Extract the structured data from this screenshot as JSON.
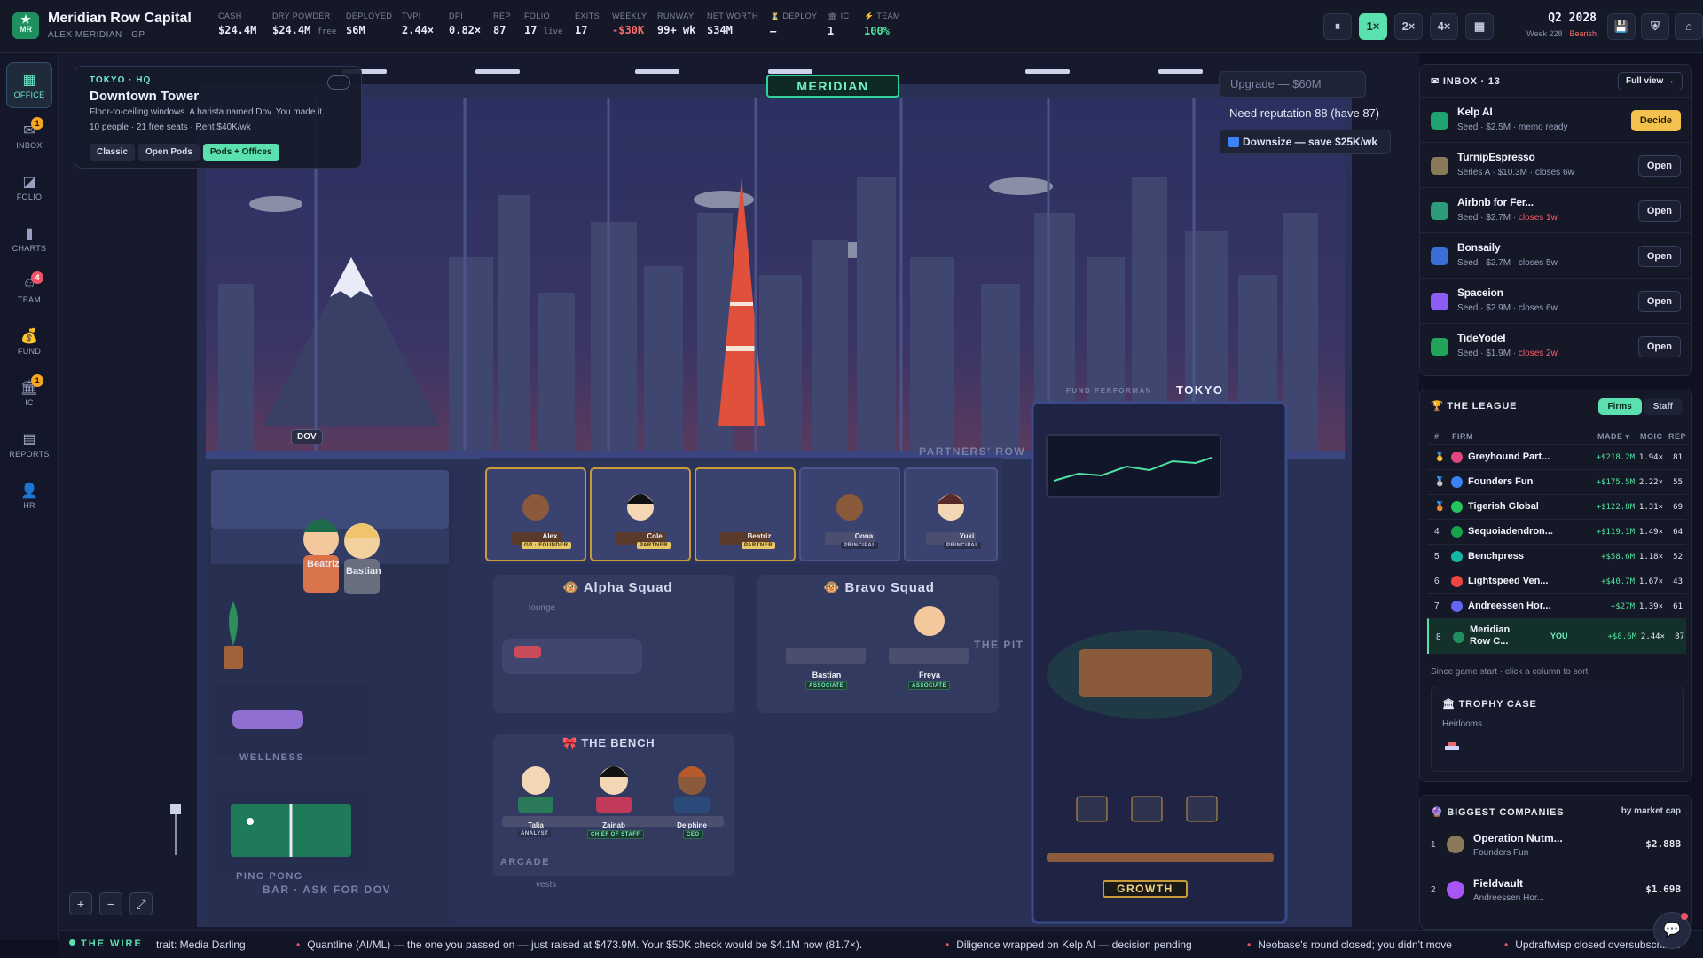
{
  "firm": {
    "name": "Meridian Row Capital",
    "sub": "ALEX MERIDIAN · GP",
    "logo": "MR"
  },
  "stats": [
    {
      "label": "CASH",
      "value": "$24.4M",
      "suffix": "",
      "color": ""
    },
    {
      "label": "DRY POWDER",
      "value": "$24.4M",
      "suffix": "free",
      "color": ""
    },
    {
      "label": "DEPLOYED",
      "value": "$6M",
      "suffix": "",
      "color": ""
    },
    {
      "label": "TVPI",
      "value": "2.44×",
      "suffix": "",
      "color": ""
    },
    {
      "label": "DPI",
      "value": "0.82×",
      "suffix": "",
      "color": ""
    },
    {
      "label": "REP",
      "value": "87",
      "suffix": "",
      "color": ""
    },
    {
      "label": "FOLIO",
      "value": "17",
      "suffix": "live",
      "color": ""
    },
    {
      "label": "EXITS",
      "value": "17",
      "suffix": "",
      "color": ""
    },
    {
      "label": "WEEKLY",
      "value": "-$30K",
      "suffix": "",
      "color": "red"
    },
    {
      "label": "RUNWAY",
      "value": "99+ wk",
      "suffix": "",
      "color": ""
    },
    {
      "label": "NET WORTH",
      "value": "$34M",
      "suffix": "",
      "color": ""
    },
    {
      "label": "⏳ DEPLOY",
      "value": "—",
      "suffix": "",
      "color": ""
    },
    {
      "label": "🏛 IC",
      "value": "1",
      "suffix": "",
      "color": ""
    },
    {
      "label": "⚡ TEAM",
      "value": "100%",
      "suffix": "",
      "color": "green"
    }
  ],
  "controls": {
    "pause": "⏸",
    "speed1": "1×",
    "speed2": "2×",
    "speed4": "4×",
    "calc": "▦",
    "save": "💾",
    "settings": "⛨",
    "home": "⌂"
  },
  "date": {
    "main": "Q2 2028",
    "week": "Week 228 · ",
    "market": "Bearish"
  },
  "nav": [
    {
      "label": "OFFICE",
      "icon": "▦",
      "badge": ""
    },
    {
      "label": "INBOX",
      "icon": "✉",
      "badge": "1"
    },
    {
      "label": "FOLIO",
      "icon": "◪",
      "badge": ""
    },
    {
      "label": "CHARTS",
      "icon": "▮",
      "badge": ""
    },
    {
      "label": "TEAM",
      "icon": "☺",
      "badge": "4"
    },
    {
      "label": "FUND",
      "icon": "💰",
      "badge": ""
    },
    {
      "label": "IC",
      "icon": "🏛",
      "badge": "1"
    },
    {
      "label": "REPORTS",
      "icon": "▤",
      "badge": ""
    },
    {
      "label": "HR",
      "icon": "👤",
      "badge": ""
    }
  ],
  "office": {
    "location": "TOKYO · HQ",
    "name": "Downtown Tower",
    "desc": "Floor-to-ceiling windows. A barista named Dov. You made it.",
    "info": "10 people · 21 free seats · Rent $40K/wk",
    "minimize": "—",
    "layouts": [
      "Classic",
      "Open Pods",
      "Pods + Offices"
    ]
  },
  "upgrade": "Upgrade — $60M",
  "need_rep": "Need reputation 88 (have 87)",
  "downsize": "Downsize — save $25K/wk",
  "scene": {
    "meridian": "MERIDIAN",
    "tokyo": "TOKYO",
    "fund_perf": "FUND PERFORMAN",
    "growth": "GROWTH",
    "partners_row": "PARTNERS' ROW",
    "alpha_squad": "Alpha Squad",
    "bravo_squad": "Bravo Squad",
    "the_bench": "THE BENCH",
    "the_pit": "THE PIT",
    "lounge": "lounge",
    "wellness": "WELLNESS",
    "ping_pong": "PING PONG",
    "bar": "BAR · ASK FOR DOV",
    "arcade": "ARCADE",
    "vests": "vests",
    "dov": "DOV",
    "bar_people": [
      "Beatriz",
      "Bastian"
    ],
    "partners": [
      {
        "name": "Alex",
        "role": "GP · FOUNDER"
      },
      {
        "name": "Cole",
        "role": "PARTNER"
      },
      {
        "name": "Beatriz",
        "role": "PARTNER"
      },
      {
        "name": "Oona",
        "role": "PRINCIPAL"
      },
      {
        "name": "Yuki",
        "role": "PRINCIPAL"
      }
    ],
    "pit": [
      {
        "name": "Bastian",
        "role": "ASSOCIATE"
      },
      {
        "name": "Freya",
        "role": "ASSOCIATE"
      }
    ],
    "bench": [
      {
        "name": "Talia",
        "role": "ANALYST"
      },
      {
        "name": "Zainab",
        "role": "CHIEF OF STAFF"
      },
      {
        "name": "Delphine",
        "role": "CEO"
      }
    ],
    "zoom": {
      "in": "+",
      "out": "−",
      "fit": "⤢"
    }
  },
  "inbox": {
    "title": "INBOX · 13",
    "full_view": "Full view →",
    "items": [
      {
        "name": "Kelp AI",
        "meta": "Seed · $2.5M · ",
        "extra": "memo ready",
        "warn": "",
        "action": "Decide",
        "color": "#1fa36f"
      },
      {
        "name": "TurnipEspresso",
        "meta": "Series A · $10.3M · closes 6w",
        "extra": "",
        "warn": "",
        "action": "Open",
        "color": "#8a7a5a"
      },
      {
        "name": "Airbnb for Fer...",
        "meta": "Seed · $2.7M · ",
        "extra": "",
        "warn": "closes 1w",
        "action": "Open",
        "color": "#2f9a7a"
      },
      {
        "name": "Bonsaily",
        "meta": "Seed · $2.7M · closes 5w",
        "extra": "",
        "warn": "",
        "action": "Open",
        "color": "#3a6fd8"
      },
      {
        "name": "Spaceion",
        "meta": "Seed · $2.9M · closes 6w",
        "extra": "",
        "warn": "",
        "action": "Open",
        "color": "#8b5cf6"
      },
      {
        "name": "TideYodel",
        "meta": "Seed · $1.9M · ",
        "extra": "",
        "warn": "closes 2w",
        "action": "Open",
        "color": "#22a55a"
      }
    ]
  },
  "league": {
    "title": "THE LEAGUE",
    "tabs": [
      "Firms",
      "Staff"
    ],
    "headers": {
      "rank": "#",
      "firm": "FIRM",
      "made": "MADE ▾",
      "moic": "MOIC",
      "rep": "REP"
    },
    "rows": [
      {
        "rank": "🥇",
        "firm": "Greyhound Part...",
        "made": "+$218.2M",
        "moic": "1.94×",
        "rep": "81",
        "color": "#e0457b",
        "you": false
      },
      {
        "rank": "🥈",
        "firm": "Founders Fun",
        "made": "+$175.5M",
        "moic": "2.22×",
        "rep": "55",
        "color": "#3b82f6",
        "you": false
      },
      {
        "rank": "🥉",
        "firm": "Tigerish Global",
        "made": "+$122.8M",
        "moic": "1.31×",
        "rep": "69",
        "color": "#22c55e",
        "you": false
      },
      {
        "rank": "4",
        "firm": "Sequoiadendron...",
        "made": "+$119.1M",
        "moic": "1.49×",
        "rep": "64",
        "color": "#16a34a",
        "you": false
      },
      {
        "rank": "5",
        "firm": "Benchpress",
        "made": "+$58.6M",
        "moic": "1.18×",
        "rep": "52",
        "color": "#14b8a6",
        "you": false
      },
      {
        "rank": "6",
        "firm": "Lightspeed Ven...",
        "made": "+$40.7M",
        "moic": "1.67×",
        "rep": "43",
        "color": "#ef4444",
        "you": false
      },
      {
        "rank": "7",
        "firm": "Andreessen Hor...",
        "made": "+$27M",
        "moic": "1.39×",
        "rep": "61",
        "color": "#6366f1",
        "you": false
      },
      {
        "rank": "8",
        "firm": "Meridian Row C...",
        "made": "+$8.6M",
        "moic": "2.44×",
        "rep": "87",
        "color": "#1f8f5f",
        "you": true
      }
    ],
    "you_label": "YOU",
    "since": "Since game start · click a column to sort"
  },
  "trophy": {
    "title": "TROPHY CASE",
    "heirlooms": "Heirlooms"
  },
  "biggest": {
    "title": "BIGGEST COMPANIES",
    "by": "by market cap",
    "rows": [
      {
        "rank": "1",
        "name": "Operation Nutm...",
        "by": "Founders Fun",
        "cap": "$2.88B",
        "color": "#8a7a5a"
      },
      {
        "rank": "2",
        "name": "Fieldvault",
        "by": "Andreessen Hor...",
        "cap": "$1.69B",
        "color": "#a855f7"
      }
    ]
  },
  "ticker": {
    "label": "THE WIRE",
    "items": [
      "trait: Media Darling",
      "Quantline (AI/ML) — the one you passed on — just raised at $473.9M. Your $50K check would be $4.1M now (81.7×).",
      "Diligence wrapped on Kelp AI — decision pending",
      "Neobase's round closed; you didn't move",
      "Updraftwisp closed oversubscribed"
    ]
  },
  "chat": "💬",
  "colors": {
    "accent": "#5be0b0",
    "warning": "#ff6b6b",
    "decide": "#f2c14e",
    "brand": "#1f8f5f"
  }
}
